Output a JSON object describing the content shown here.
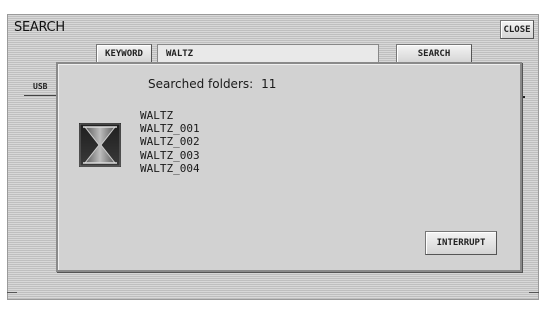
{
  "screen": {
    "title": "SEARCH",
    "close_label": "CLOSE",
    "keyword_label": "KEYWORD",
    "keyword_value": "WALTZ",
    "search_label": "SEARCH",
    "usb_label": "USB"
  },
  "dialog": {
    "searched_label": "Searched folders:",
    "searched_count": "11",
    "results": [
      "WALTZ",
      "WALTZ_001",
      "WALTZ_002",
      "WALTZ_003",
      "WALTZ_004"
    ],
    "interrupt_label": "INTERRUPT",
    "icon": "hourglass-icon"
  }
}
